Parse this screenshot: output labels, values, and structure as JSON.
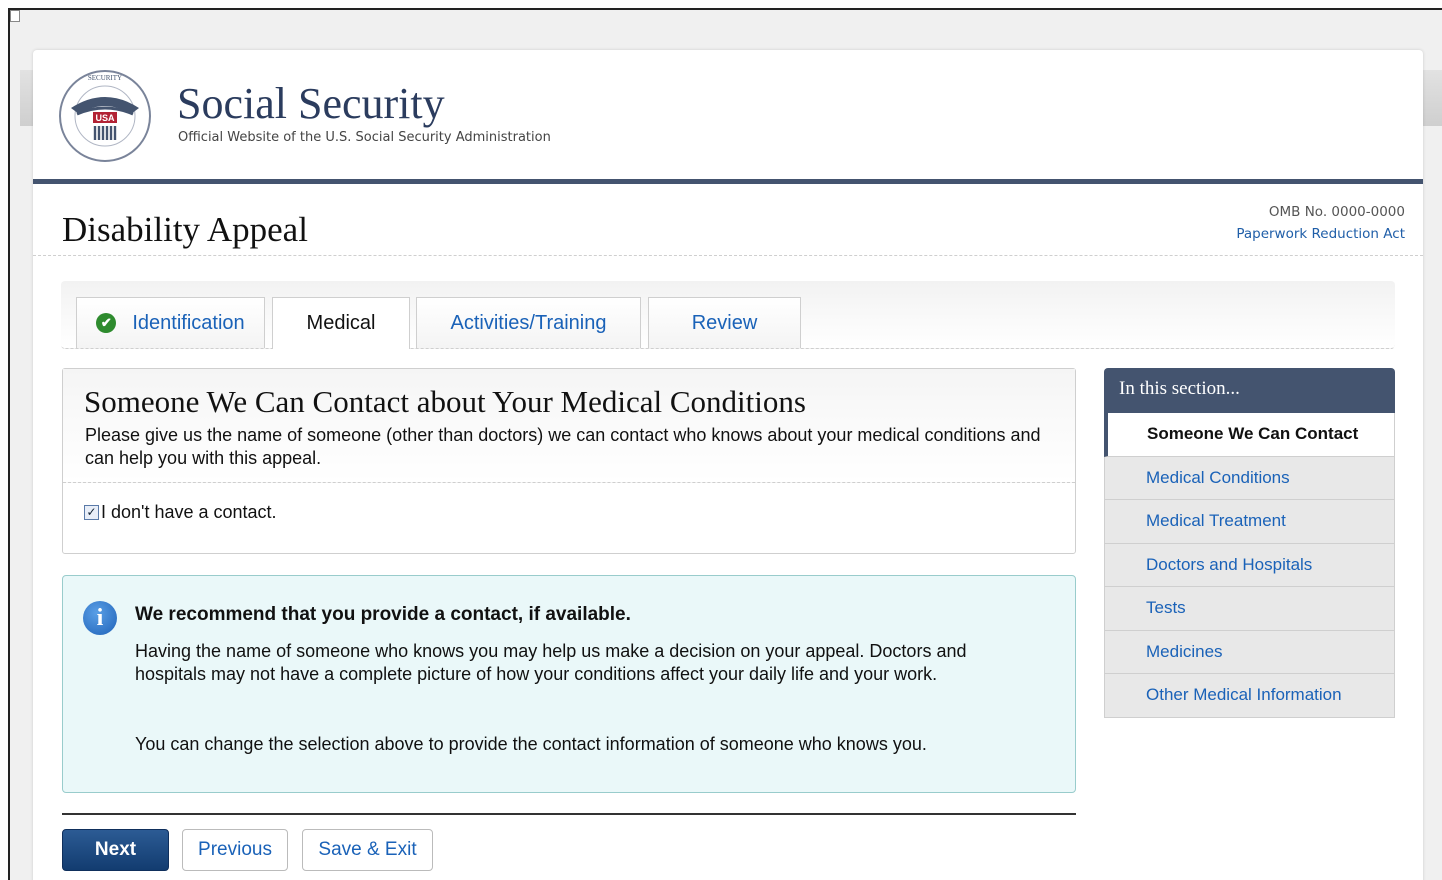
{
  "site": {
    "title": "Social Security",
    "subtitle": "Official Website of the U.S. Social Security Administration",
    "logo_icon": "ssa-seal-icon",
    "logo_text_ring": "SOCIAL SECURITY ADMINISTRATION",
    "logo_center_text": "USA"
  },
  "page": {
    "title": "Disability Appeal",
    "omb": "OMB No. 0000-0000",
    "paperwork_link": "Paperwork Reduction Act"
  },
  "tabs": [
    {
      "label": "Identification",
      "completed": true,
      "active": false
    },
    {
      "label": "Medical",
      "completed": false,
      "active": true
    },
    {
      "label": "Activities/Training",
      "completed": false,
      "active": false
    },
    {
      "label": "Review",
      "completed": false,
      "active": false
    }
  ],
  "section": {
    "title": "Someone We Can Contact about Your Medical Conditions",
    "description": "Please give us the name of someone (other than doctors) we can contact who knows about your medical conditions and can help you with this appeal.",
    "checkbox_label": "I don't have a contact.",
    "checkbox_checked": true
  },
  "info": {
    "title": "We recommend that you provide a contact, if available.",
    "paragraph1": "Having the name of someone who knows you may help us make a decision on your appeal. Doctors and hospitals may not have a complete picture of how your conditions affect your daily life and your work.",
    "paragraph2": "You can change the selection above to provide the contact information of someone who knows you."
  },
  "buttons": {
    "next": "Next",
    "previous": "Previous",
    "save_exit": "Save & Exit"
  },
  "side_nav": {
    "heading": "In this section...",
    "items": [
      {
        "label": "Someone We Can Contact",
        "active": true
      },
      {
        "label": "Medical Conditions",
        "active": false
      },
      {
        "label": "Medical Treatment",
        "active": false
      },
      {
        "label": "Doctors and Hospitals",
        "active": false
      },
      {
        "label": "Tests",
        "active": false
      },
      {
        "label": "Medicines",
        "active": false
      },
      {
        "label": "Other Medical Information",
        "active": false
      }
    ]
  },
  "colors": {
    "brand_navy": "#44546f",
    "link_blue": "#1a62b8",
    "info_bg": "#eaf8f9",
    "success_green": "#2e8b2e"
  }
}
